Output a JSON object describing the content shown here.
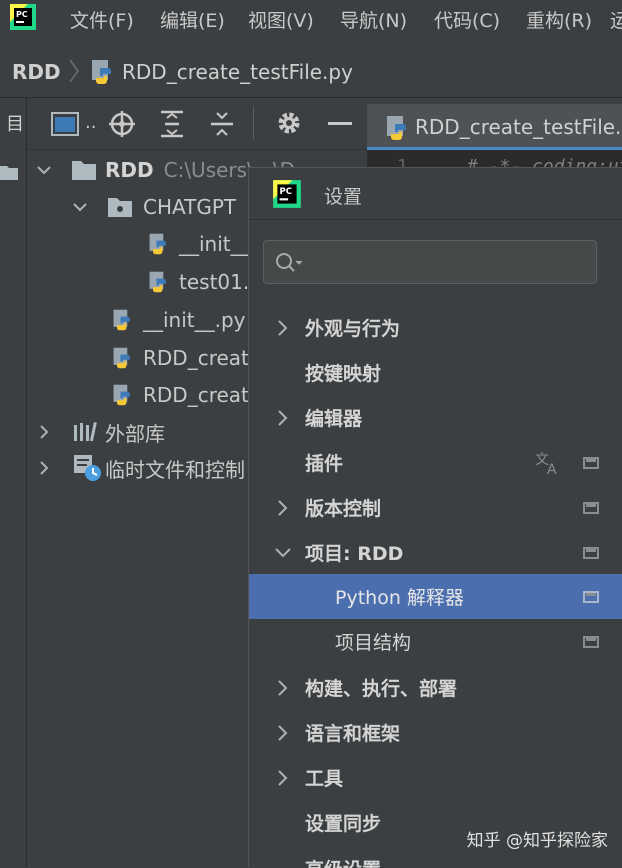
{
  "menubar": {
    "items": [
      "文件(F)",
      "编辑(E)",
      "视图(V)",
      "导航(N)",
      "代码(C)",
      "重构(R)",
      "运"
    ]
  },
  "navbar": {
    "project": "RDD",
    "file": "RDD_create_testFile.py"
  },
  "editor": {
    "tab_label": "RDD_create_testFile.",
    "line_number": "1",
    "code_line": "# -*- coding:ut"
  },
  "project_toolbar": {
    "dropdown_label": ".."
  },
  "left_strip": {
    "label": "目"
  },
  "tree": {
    "items": [
      {
        "label": "RDD",
        "path": "C:\\Users\\...\\D"
      },
      {
        "label": "CHATGPT"
      },
      {
        "label": "__init__"
      },
      {
        "label": "test01."
      },
      {
        "label": "__init__.py"
      },
      {
        "label": "RDD_creat"
      },
      {
        "label": "RDD_creat"
      },
      {
        "label": "外部库"
      },
      {
        "label": "临时文件和控制"
      }
    ]
  },
  "settings": {
    "title": "设置",
    "search_placeholder": "",
    "items": [
      {
        "label": "外观与行为"
      },
      {
        "label": "按键映射"
      },
      {
        "label": "编辑器"
      },
      {
        "label": "插件"
      },
      {
        "label": "版本控制"
      },
      {
        "label": "项目: RDD"
      },
      {
        "label": "Python 解释器"
      },
      {
        "label": "项目结构"
      },
      {
        "label": "构建、执行、部署"
      },
      {
        "label": "语言和框架"
      },
      {
        "label": "工具"
      },
      {
        "label": "设置同步"
      },
      {
        "label": "高级设置"
      }
    ]
  },
  "watermark": "知乎 @知乎探险家",
  "colors": {
    "background": "#3c3f41",
    "editor_bg": "#2b2b2b",
    "selection": "#4b6eaf",
    "tab_underline": "#4a88c7"
  }
}
